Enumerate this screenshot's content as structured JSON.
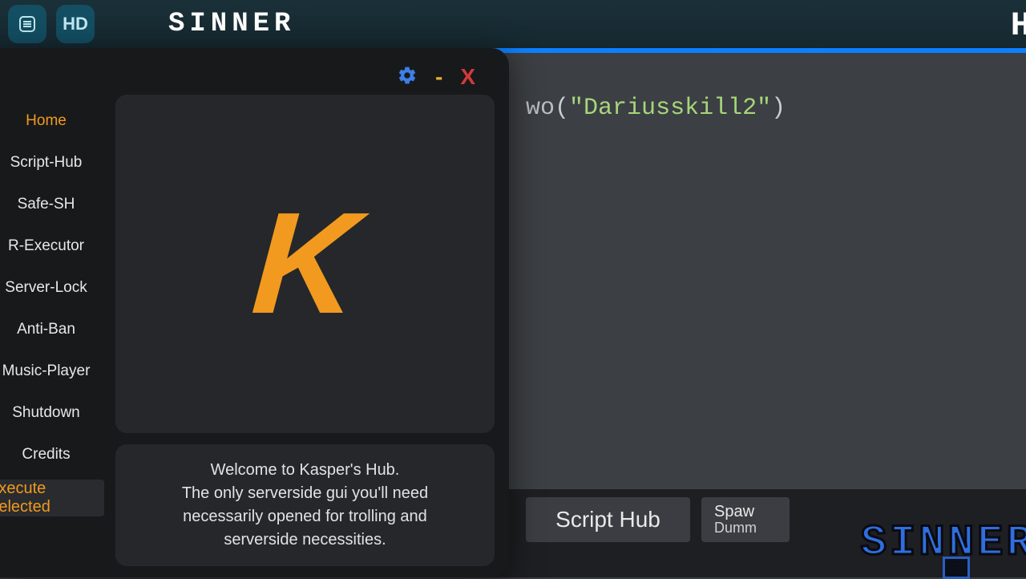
{
  "topbar": {
    "icon1_name": "menu-lines-icon",
    "icon2_label": "HD",
    "game_title": "SINNER",
    "right_fragment": "H"
  },
  "code": {
    "line1_func": "wo",
    "line1_arg": "\"Dariusskill2\""
  },
  "bottom": {
    "script_hub": "Script Hub",
    "spawn_top": "Spaw",
    "spawn_bottom": "Dumm"
  },
  "logo_text": "SINNER",
  "hub": {
    "titlebar": {
      "min": "-",
      "close": "X"
    },
    "sidebar": {
      "items": [
        {
          "label": "Home",
          "active": true
        },
        {
          "label": "Script-Hub",
          "active": false
        },
        {
          "label": "Safe-SH",
          "active": false
        },
        {
          "label": "R-Executor",
          "active": false
        },
        {
          "label": "Server-Lock",
          "active": false
        },
        {
          "label": "Anti-Ban",
          "active": false
        },
        {
          "label": "Music-Player",
          "active": false
        },
        {
          "label": "Shutdown",
          "active": false
        },
        {
          "label": "Credits",
          "active": false
        }
      ],
      "execute_label": "Execute Selected"
    },
    "logo_letter": "K",
    "welcome": "Welcome to Kasper's Hub.\nThe only serverside gui you'll need\nnecessarily opened for trolling and\nserverside necessities."
  }
}
